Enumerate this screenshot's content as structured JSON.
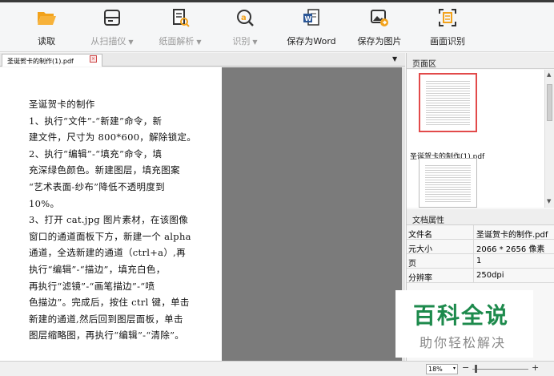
{
  "toolbar": {
    "read": "读取",
    "scanner": "从扫描仪",
    "parse": "纸面解析",
    "recognize": "识别",
    "save_word": "保存为Word",
    "save_image": "保存为图片",
    "page_ocr": "画面识别",
    "dropdown_glyph": "▼"
  },
  "tab": {
    "filename": "圣诞贺卡的制作(1).pdf",
    "close_glyph": "×",
    "dropdown_glyph": "▼"
  },
  "document": {
    "lines": [
      "圣诞贺卡的制作",
      "1、执行“文件”-“新建”命令，新",
      "建文件，尺寸为 800*600，解除锁定。",
      "2、执行“编辑”-“填充”命令，填",
      "充深绿色颜色。新建图层，填充图案",
      "“艺术表面-纱布”降低不透明度到",
      "10%。",
      "3、打开 cat.jpg 图片素材，在该图像",
      "窗口的通道面板下方，新建一个 alpha",
      "通道，全选新建的通道（ctrl+a）,再",
      "执行“编辑”-“描边”，填充白色，",
      "再执行“滤镜”-“画笔描边”-“喷",
      "色描边”。完成后，按住 ctrl 键，单击",
      "新建的通道,然后回到图层面板，单击",
      "图层缩略图，再执行“编辑”-“清除”。"
    ]
  },
  "right_panel": {
    "pages_header": "页面区",
    "thumb_caption": "圣诞贺卡的制作(1).pdf",
    "props_header": "文档属性",
    "properties": [
      {
        "key": "文件名",
        "value": "圣诞贺卡的制作.pdf"
      },
      {
        "key": "元大小",
        "value": "2066 * 2656 像素"
      },
      {
        "key": "页",
        "value": "1"
      },
      {
        "key": "分辨率",
        "value": "250dpi"
      }
    ]
  },
  "watermark": {
    "title": "百科全说",
    "subtitle": "助你轻松解决"
  },
  "status": {
    "zoom": "18%",
    "zoom_minus": "−",
    "zoom_plus": "+",
    "dropdown_glyph": "▾"
  },
  "colors": {
    "accent_orange": "#f2a21b",
    "watermark_green": "#1d8a4c",
    "selection_red": "#e24a4a"
  }
}
